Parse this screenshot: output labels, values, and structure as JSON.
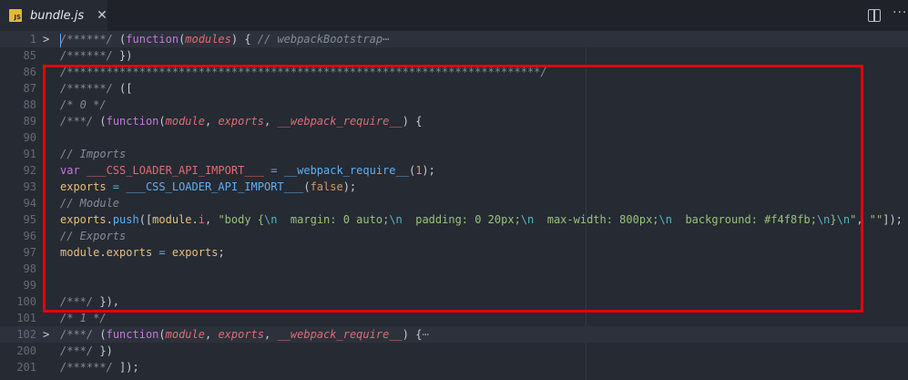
{
  "tab": {
    "title": "bundle.js",
    "icon": "js-file-icon",
    "icon_label": "JS",
    "close_glyph": "✕"
  },
  "toolbar": {
    "split_icon": "split-editor-icon",
    "more_glyph": "···"
  },
  "colors": {
    "selection_box": "#e3000f",
    "background": "#262a33"
  },
  "lines": [
    {
      "num": "1",
      "folded": true,
      "fold_glyph": ">",
      "ellipsis": "⋯",
      "tokens": [
        {
          "t": "/******/ ",
          "c": "c"
        },
        {
          "t": "(",
          "c": "pt"
        },
        {
          "t": "function",
          "c": "f"
        },
        {
          "t": "(",
          "c": "pt"
        },
        {
          "t": "modules",
          "c": "p"
        },
        {
          "t": ") { ",
          "c": "pt"
        },
        {
          "t": "// webpackBootstrap",
          "c": "c"
        }
      ]
    },
    {
      "num": "85",
      "tokens": [
        {
          "t": "/******/ ",
          "c": "c"
        },
        {
          "t": "})",
          "c": "pt"
        }
      ]
    },
    {
      "num": "86",
      "tokens": [
        {
          "t": "/************************************************************************/",
          "c": "c"
        }
      ]
    },
    {
      "num": "87",
      "tokens": [
        {
          "t": "/******/ ",
          "c": "c"
        },
        {
          "t": "([",
          "c": "pt"
        }
      ]
    },
    {
      "num": "88",
      "tokens": [
        {
          "t": "/* 0 */",
          "c": "c"
        }
      ]
    },
    {
      "num": "89",
      "tokens": [
        {
          "t": "/***/ ",
          "c": "c"
        },
        {
          "t": "(",
          "c": "pt"
        },
        {
          "t": "function",
          "c": "f"
        },
        {
          "t": "(",
          "c": "pt"
        },
        {
          "t": "module",
          "c": "p"
        },
        {
          "t": ", ",
          "c": "pt"
        },
        {
          "t": "exports",
          "c": "p"
        },
        {
          "t": ", ",
          "c": "pt"
        },
        {
          "t": "__webpack_require__",
          "c": "p"
        },
        {
          "t": ") {",
          "c": "pt"
        }
      ]
    },
    {
      "num": "90",
      "tokens": []
    },
    {
      "num": "91",
      "tokens": [
        {
          "t": "// Imports",
          "c": "c"
        }
      ]
    },
    {
      "num": "92",
      "tokens": [
        {
          "t": "var ",
          "c": "f"
        },
        {
          "t": "___CSS_LOADER_API_IMPORT___",
          "c": "kw"
        },
        {
          "t": " = ",
          "c": "esc"
        },
        {
          "t": "__webpack_require__",
          "c": "fn"
        },
        {
          "t": "(",
          "c": "pt"
        },
        {
          "t": "1",
          "c": "n"
        },
        {
          "t": ");",
          "c": "pt"
        }
      ]
    },
    {
      "num": "93",
      "tokens": [
        {
          "t": "exports",
          "c": "y"
        },
        {
          "t": " = ",
          "c": "esc"
        },
        {
          "t": "___CSS_LOADER_API_IMPORT___",
          "c": "fn"
        },
        {
          "t": "(",
          "c": "pt"
        },
        {
          "t": "false",
          "c": "n"
        },
        {
          "t": ");",
          "c": "pt"
        }
      ]
    },
    {
      "num": "94",
      "tokens": [
        {
          "t": "// Module",
          "c": "c"
        }
      ]
    },
    {
      "num": "95",
      "tokens": [
        {
          "t": "exports",
          "c": "y"
        },
        {
          "t": ".",
          "c": "pt"
        },
        {
          "t": "push",
          "c": "fn"
        },
        {
          "t": "([",
          "c": "pt"
        },
        {
          "t": "module",
          "c": "y"
        },
        {
          "t": ".",
          "c": "pt"
        },
        {
          "t": "i",
          "c": "kw"
        },
        {
          "t": ", ",
          "c": "pt"
        },
        {
          "t": "\"body {",
          "c": "s"
        },
        {
          "t": "\\n",
          "c": "esc"
        },
        {
          "t": "  margin: 0 auto;",
          "c": "s"
        },
        {
          "t": "\\n",
          "c": "esc"
        },
        {
          "t": "  padding: 0 20px;",
          "c": "s"
        },
        {
          "t": "\\n",
          "c": "esc"
        },
        {
          "t": "  max-width: 800px;",
          "c": "s"
        },
        {
          "t": "\\n",
          "c": "esc"
        },
        {
          "t": "  background: #f4f8fb;",
          "c": "s"
        },
        {
          "t": "\\n",
          "c": "esc"
        },
        {
          "t": "}",
          "c": "s"
        },
        {
          "t": "\\n",
          "c": "esc"
        },
        {
          "t": "\"",
          "c": "s"
        },
        {
          "t": ", ",
          "c": "pt"
        },
        {
          "t": "\"\"",
          "c": "s"
        },
        {
          "t": "]);",
          "c": "pt"
        }
      ]
    },
    {
      "num": "96",
      "tokens": [
        {
          "t": "// Exports",
          "c": "c"
        }
      ]
    },
    {
      "num": "97",
      "tokens": [
        {
          "t": "module",
          "c": "y"
        },
        {
          "t": ".",
          "c": "pt"
        },
        {
          "t": "exports",
          "c": "y"
        },
        {
          "t": " = ",
          "c": "esc"
        },
        {
          "t": "exports",
          "c": "y"
        },
        {
          "t": ";",
          "c": "pt"
        }
      ]
    },
    {
      "num": "98",
      "tokens": []
    },
    {
      "num": "99",
      "tokens": []
    },
    {
      "num": "100",
      "tokens": [
        {
          "t": "/***/ ",
          "c": "c"
        },
        {
          "t": "}),",
          "c": "pt"
        }
      ]
    },
    {
      "num": "101",
      "tokens": [
        {
          "t": "/* 1 */",
          "c": "c"
        }
      ]
    },
    {
      "num": "102",
      "folded": true,
      "fold_glyph": ">",
      "ellipsis": "⋯",
      "tokens": [
        {
          "t": "/***/ ",
          "c": "c"
        },
        {
          "t": "(",
          "c": "pt"
        },
        {
          "t": "function",
          "c": "f"
        },
        {
          "t": "(",
          "c": "pt"
        },
        {
          "t": "module",
          "c": "p"
        },
        {
          "t": ", ",
          "c": "pt"
        },
        {
          "t": "exports",
          "c": "p"
        },
        {
          "t": ", ",
          "c": "pt"
        },
        {
          "t": "__webpack_require__",
          "c": "p"
        },
        {
          "t": ") {",
          "c": "pt"
        }
      ]
    },
    {
      "num": "200",
      "tokens": [
        {
          "t": "/***/ ",
          "c": "c"
        },
        {
          "t": "})",
          "c": "pt"
        }
      ]
    },
    {
      "num": "201",
      "tokens": [
        {
          "t": "/******/ ",
          "c": "c"
        },
        {
          "t": "]);",
          "c": "pt"
        }
      ]
    }
  ]
}
